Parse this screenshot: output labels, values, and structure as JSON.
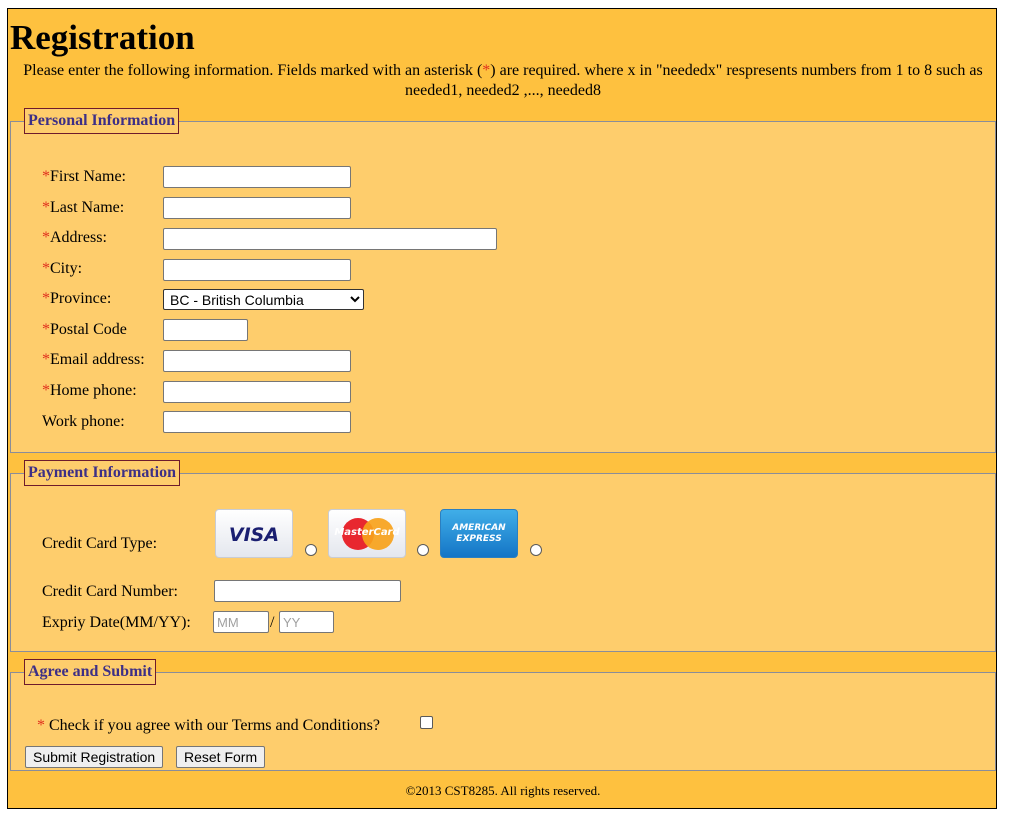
{
  "heading": "Registration",
  "intro": {
    "before": "Please enter the following information. Fields marked with an asterisk (",
    "asterisk": "*",
    "after": ") are required. where x in \"neededx\" respresents numbers from 1 to 8 such as needed1, needed2 ,..., needed8"
  },
  "personal": {
    "legend": "Personal Information",
    "required_mark": "*",
    "fields": {
      "first_name": {
        "label": "First Name:",
        "value": ""
      },
      "last_name": {
        "label": "Last Name:",
        "value": ""
      },
      "address": {
        "label": "Address:",
        "value": ""
      },
      "city": {
        "label": "City:",
        "value": ""
      },
      "province": {
        "label": "Province:",
        "selected": "BC - British Columbia"
      },
      "postal_code": {
        "label": "Postal Code",
        "value": ""
      },
      "email": {
        "label": "Email address:",
        "value": ""
      },
      "home_phone": {
        "label": "Home phone:",
        "value": ""
      },
      "work_phone": {
        "label": "Work phone:",
        "value": ""
      }
    }
  },
  "payment": {
    "legend": "Payment Information",
    "card_type_label": "Credit Card Type:",
    "cards": [
      {
        "name": "visa-card-logo",
        "text": "VISA",
        "selected": false
      },
      {
        "name": "mastercard-card-logo",
        "text": "MasterCard",
        "selected": false
      },
      {
        "name": "amex-card-logo",
        "text_line1": "AMERICAN",
        "text_line2": "EXPRESS",
        "selected": false
      }
    ],
    "card_number_label": "Credit Card Number:",
    "card_number_value": "",
    "expiry_label": "Expriy Date(MM/YY):",
    "expiry_mm_placeholder": "MM",
    "expiry_separator": "/",
    "expiry_yy_placeholder": "YY"
  },
  "agree": {
    "legend": "Agree and Submit",
    "required_mark": "*",
    "terms_label": "Check if you agree with our Terms and Conditions?",
    "terms_checked": false,
    "submit_label": "Submit Registration",
    "reset_label": "Reset Form"
  },
  "footer": "©2013 CST8285. All rights reserved.",
  "colors": {
    "page_background": "#fec13f",
    "fieldset_background": "#fecd6c",
    "legend_text": "#3d2f86",
    "required_asterisk": "#e0301e"
  }
}
